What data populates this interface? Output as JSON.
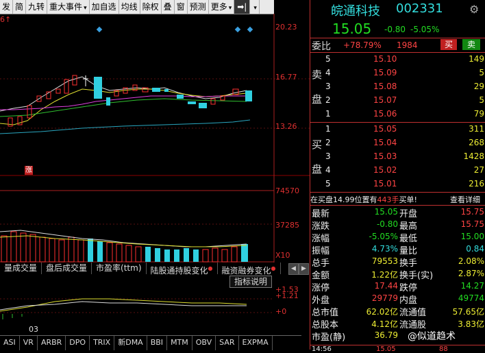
{
  "toolbar": {
    "items": [
      "发",
      "简",
      "九转",
      "重大事件",
      "加自选",
      "均线",
      "除权",
      "叠",
      "窗",
      "预测",
      "更多"
    ],
    "arrow_label": "➡|"
  },
  "chart": {
    "top_left_label": "6↑",
    "price_ticks": [
      "20.23",
      "16.77",
      "13.26"
    ],
    "vol_ticks": [
      "74570",
      "37285",
      "X10"
    ],
    "sub_ticks": [
      "+1.53",
      "+1.21",
      "+0"
    ],
    "zhang_label": "涨",
    "date_label": "03"
  },
  "indicator_tabs": [
    {
      "label": "量成交量",
      "dot": false
    },
    {
      "label": "盘后成交量",
      "dot": false
    },
    {
      "label": "市盈率(ttm)",
      "dot": false
    },
    {
      "label": "陆股通持股变化",
      "dot": true
    },
    {
      "label": "融资融券变化",
      "dot": true
    }
  ],
  "indicator_button": "指标说明",
  "bottom_tabs": [
    "ASI",
    "VR",
    "ARBR",
    "DPO",
    "TRIX",
    "新DMA",
    "BBI",
    "MTM",
    "OBV",
    "SAR",
    "EXPMA"
  ],
  "quote": {
    "name": "皖通科技",
    "code": "002331",
    "price": "15.05",
    "change": "-0.80",
    "change_pct": "-5.05%",
    "weibi_label": "委比",
    "weibi_value": "+78.79%",
    "weicha_value": "1984",
    "buy_btn": "买",
    "sell_btn": "卖",
    "sell_label_chars": [
      "卖",
      "盘"
    ],
    "buy_label_chars": [
      "买",
      "盘"
    ],
    "sell_levels": [
      {
        "level": "5",
        "price": "15.10",
        "vol": "149"
      },
      {
        "level": "4",
        "price": "15.09",
        "vol": "5"
      },
      {
        "level": "3",
        "price": "15.08",
        "vol": "29"
      },
      {
        "level": "2",
        "price": "15.07",
        "vol": "5"
      },
      {
        "level": "1",
        "price": "15.06",
        "vol": "79"
      }
    ],
    "buy_levels": [
      {
        "level": "1",
        "price": "15.05",
        "vol": "311"
      },
      {
        "level": "2",
        "price": "15.04",
        "vol": "268"
      },
      {
        "level": "3",
        "price": "15.03",
        "vol": "1428"
      },
      {
        "level": "4",
        "price": "15.02",
        "vol": "27"
      },
      {
        "level": "5",
        "price": "15.01",
        "vol": "216"
      }
    ],
    "notice_prefix": "在买盘14.99位置有",
    "notice_amount": "443手",
    "notice_suffix": "买单!",
    "detail_link": "查看详细",
    "stats": [
      {
        "l": "最新",
        "v": "15.05",
        "r": "开盘",
        "rv": "15.75"
      },
      {
        "l": "涨跌",
        "v": "-0.80",
        "r": "最高",
        "rv": "15.75"
      },
      {
        "l": "涨幅",
        "v": "-5.05%",
        "r": "最低",
        "rv": "15.00"
      },
      {
        "l": "振幅",
        "v": "4.73%",
        "r": "量比",
        "rv": "0.84"
      },
      {
        "l": "总手",
        "v": "79553",
        "r": "换手",
        "rv": "2.08%"
      },
      {
        "l": "金额",
        "v": "1.22亿",
        "r": "换手(实)",
        "rv": "2.87%"
      },
      {
        "l": "涨停",
        "v": "17.44",
        "r": "跌停",
        "rv": "14.27"
      },
      {
        "l": "外盘",
        "v": "29779",
        "r": "内盘",
        "rv": "49774"
      },
      {
        "l": "总市值",
        "v": "62.02亿",
        "r": "流通值",
        "rv": "57.65亿"
      },
      {
        "l": "总股本",
        "v": "4.12亿",
        "r": "流通股",
        "rv": "3.83亿"
      },
      {
        "l": "市盈(静)",
        "v": "36.79",
        "r": "",
        "rv": ""
      }
    ],
    "watermark": "@似道趋术",
    "bottom_time": "14:56",
    "bottom_price": "15.05",
    "bottom_vol": "88"
  }
}
